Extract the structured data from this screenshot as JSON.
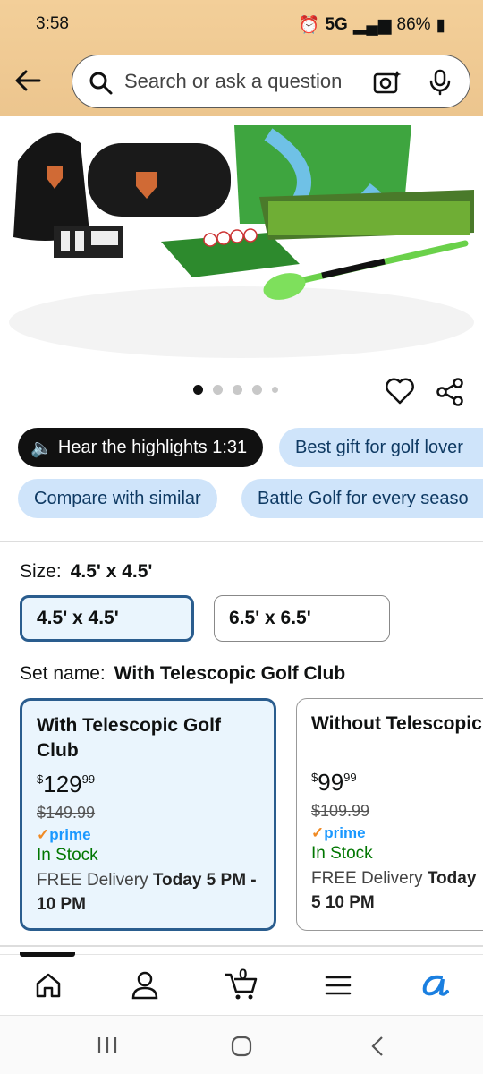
{
  "status_bar": {
    "time": "3:58",
    "network": "5G",
    "battery": "86%"
  },
  "search": {
    "placeholder": "Search or ask a question"
  },
  "carousel": {
    "count": 5,
    "active": 0
  },
  "chips": {
    "hear_highlights": "Hear the highlights 1:31",
    "best_gift": "Best gift for golf lover",
    "compare": "Compare with similar",
    "every_season": "Battle Golf for every seaso"
  },
  "size": {
    "label": "Size:",
    "selected": "4.5' x 4.5'",
    "options": [
      "4.5' x 4.5'",
      "6.5' x 6.5'"
    ]
  },
  "set_name": {
    "label": "Set name:",
    "selected": "With Telescopic Golf Club"
  },
  "variants": [
    {
      "title": "With Telescopic Golf Club",
      "currency": "$",
      "price_whole": "129",
      "price_fraction": "99",
      "list_price": "$149.99",
      "prime": "prime",
      "stock": "In Stock",
      "delivery_prefix": "FREE Delivery",
      "delivery_time": "Today 5 PM - 10 PM"
    },
    {
      "title": "Without Telescopic",
      "currency": "$",
      "price_whole": "99",
      "price_fraction": "99",
      "list_price": "$109.99",
      "prime": "prime",
      "stock": "In Stock",
      "delivery_prefix": "FREE Delivery",
      "delivery_time": "Today 5 10 PM"
    }
  ],
  "bottom_nav": {
    "cart_count": "0"
  },
  "colors": {
    "header": "#f3cf99",
    "chip_light": "#cfe4fa",
    "selected_border": "#2a5d8e",
    "prime_blue": "#1a98ff",
    "stock_green": "#007600"
  }
}
